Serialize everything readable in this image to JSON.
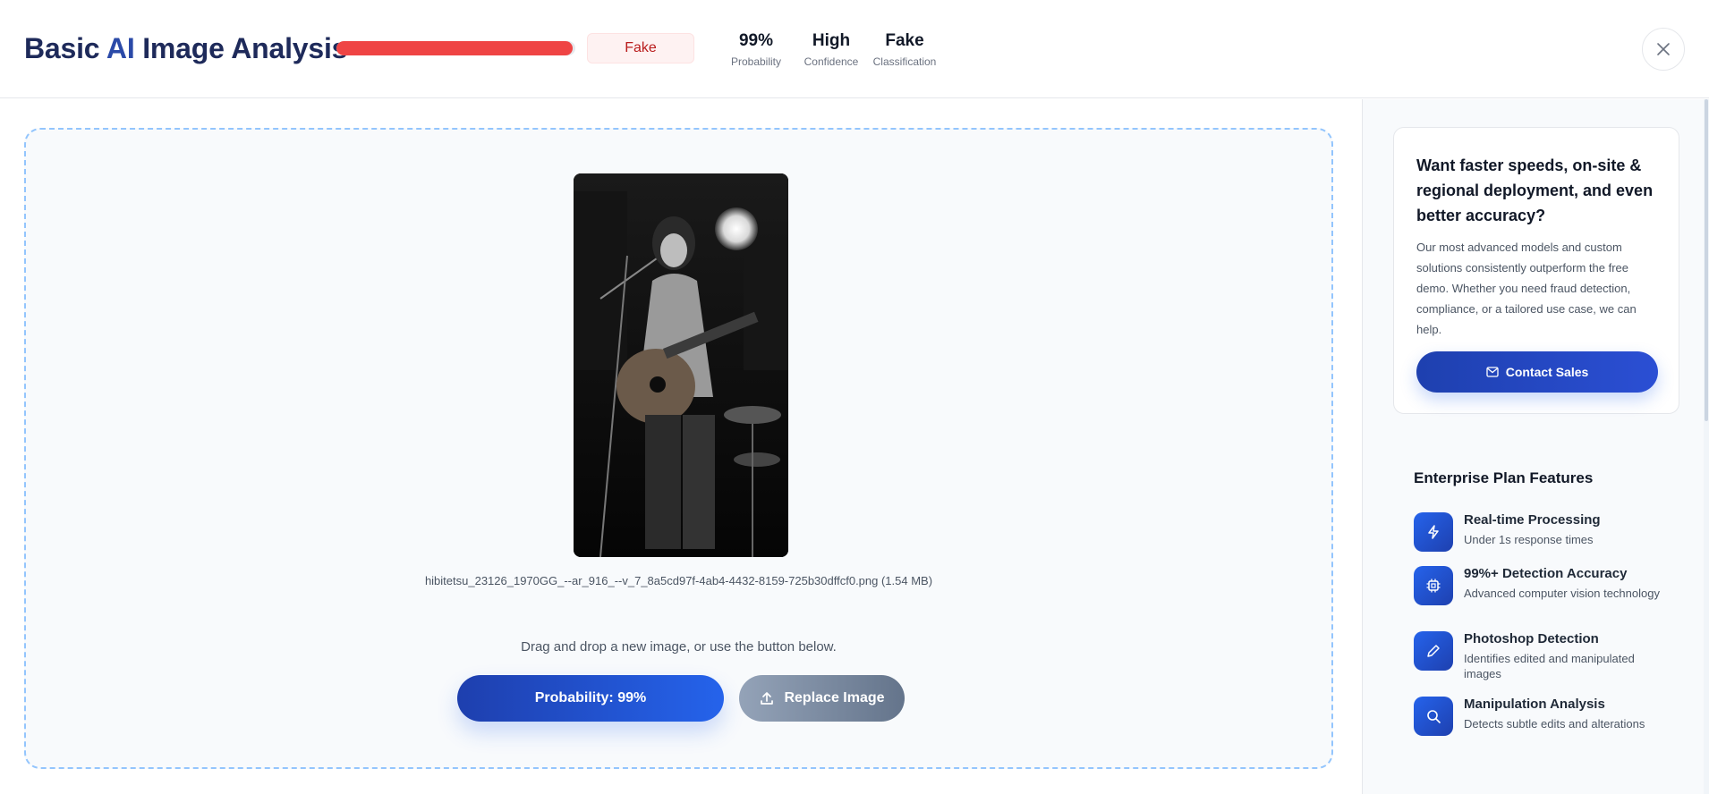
{
  "header": {
    "title_part1": "Basic",
    "title_ai": "AI",
    "title_part2": "Image Analysis",
    "probability_fill": 0.99,
    "verdict": "Fake",
    "stats": [
      {
        "value": "99%",
        "label": "Probability"
      },
      {
        "value": "High",
        "label": "Confidence"
      },
      {
        "value": "Fake",
        "label": "Classification"
      }
    ]
  },
  "main": {
    "filename": "hibitetsu_23126_1970GG_--ar_916_--v_7_8a5cd97f-4ab4-4432-8159-725b30dffcf0.png (1.54 MB)",
    "hint": "Drag and drop a new image, or use the button below.",
    "probability_button": "Probability: 99%",
    "replace_button": "Replace Image"
  },
  "sidebar": {
    "promo_title": "Want faster speeds, on-site & regional deployment, and even better accuracy?",
    "promo_text": "Our most advanced models and custom solutions consistently outperform the free demo. Whether you need fraud detection, compliance, or a tailored use case, we can help.",
    "contact_button": "Contact Sales",
    "features_title": "Enterprise Plan Features",
    "features": [
      {
        "title": "Real-time Processing",
        "desc": "Under 1s response times",
        "icon": "lightning-icon"
      },
      {
        "title": "99%+ Detection Accuracy",
        "desc": "Advanced computer vision technology",
        "icon": "chip-icon"
      },
      {
        "title": "Photoshop Detection",
        "desc": "Identifies edited and manipulated images",
        "icon": "pencil-icon"
      },
      {
        "title": "Manipulation Analysis",
        "desc": "Detects subtle edits and alterations",
        "icon": "search-icon"
      }
    ]
  },
  "colors": {
    "accent": "#2563eb",
    "danger": "#ef4444",
    "title": "#1e2a5a"
  }
}
